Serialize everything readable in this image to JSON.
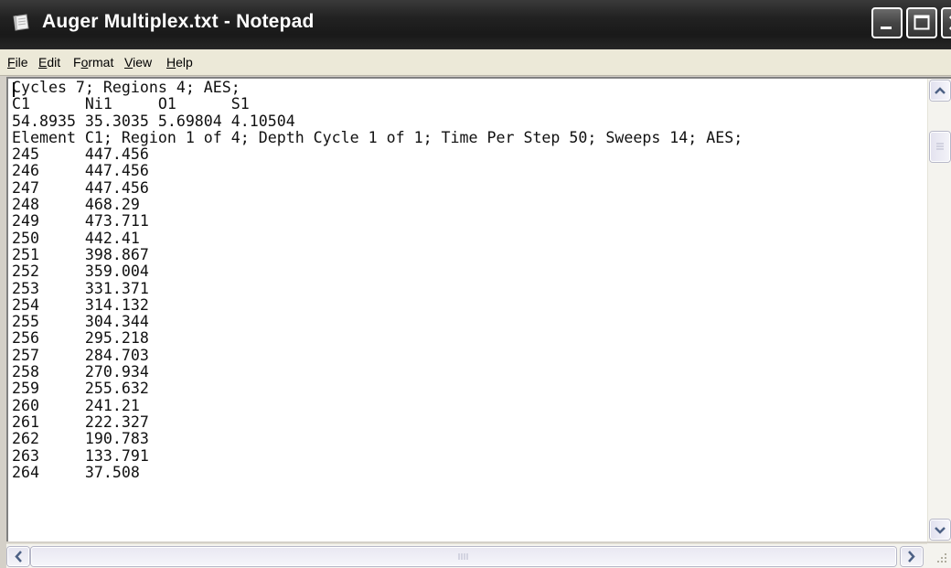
{
  "window": {
    "title": "Auger Multiplex.txt - Notepad",
    "accent": "#222222"
  },
  "menu": [
    {
      "hotkey": "F",
      "rest": "ile"
    },
    {
      "hotkey": "E",
      "rest": "dit"
    },
    {
      "pre": "F",
      "hotkey": "o",
      "rest": "rmat"
    },
    {
      "hotkey": "V",
      "rest": "iew"
    },
    {
      "hotkey": "H",
      "rest": "elp"
    }
  ],
  "document": {
    "lines": [
      "Cycles 7; Regions 4; AES;",
      "C1      Ni1     O1      S1",
      "54.8935 35.3035 5.69804 4.10504",
      "Element C1; Region 1 of 4; Depth Cycle 1 of 1; Time Per Step 50; Sweeps 14; AES;",
      "245     447.456",
      "246     447.456",
      "247     447.456",
      "248     468.29",
      "249     473.711",
      "250     442.41",
      "251     398.867",
      "252     359.004",
      "253     331.371",
      "254     314.132",
      "255     304.344",
      "256     295.218",
      "257     284.703",
      "258     270.934",
      "259     255.632",
      "260     241.21",
      "261     222.327",
      "262     190.783",
      "263     133.791",
      "264     37.508"
    ]
  },
  "icons": {
    "app": "notepad-icon",
    "minimize": "minimize-icon",
    "maximize": "maximize-icon",
    "close": "close-icon",
    "scroll_up": "arrow-up-icon",
    "scroll_down": "arrow-down-icon",
    "scroll_left": "arrow-left-icon",
    "scroll_right": "arrow-right-icon"
  }
}
